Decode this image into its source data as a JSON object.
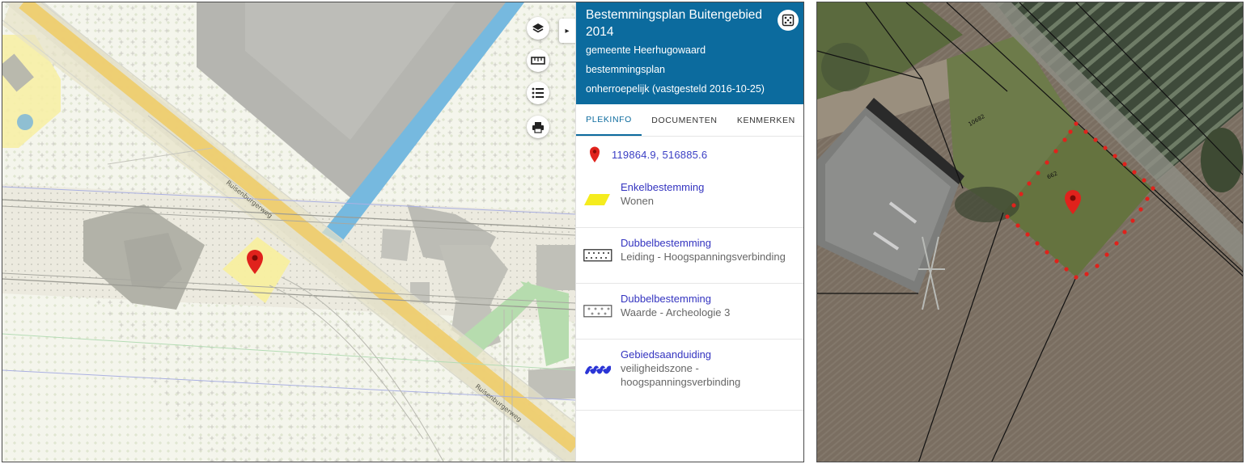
{
  "viewer": {
    "header": {
      "title": "Bestemmingsplan Buitengebied 2014",
      "municipality": "gemeente Heerhugowaard",
      "plan_type": "bestemmingsplan",
      "status": "onherroepelijk (vastgesteld 2016-10-25)"
    },
    "tabs": [
      {
        "label": "PLEKINFO",
        "active": true
      },
      {
        "label": "DOCUMENTEN",
        "active": false
      },
      {
        "label": "KENMERKEN",
        "active": false
      }
    ],
    "coordinates": "119864.9, 516885.6",
    "entries": [
      {
        "type": "Enkelbestemming",
        "name": "Wonen",
        "symbol": "yellow-parallelogram-icon"
      },
      {
        "type": "Dubbelbestemming",
        "name": "Leiding - Hoogspanningsverbinding",
        "symbol": "dotted-box-icon"
      },
      {
        "type": "Dubbelbestemming",
        "name": "Waarde - Archeologie 3",
        "symbol": "cross-hatch-box-icon"
      },
      {
        "type": "Gebiedsaanduiding",
        "name": "veiligheidszone - hoogspanningsverbinding",
        "symbol": "blue-zone-icon"
      }
    ],
    "map": {
      "street_label_1": "Ruisenburgerweg",
      "street_label_2": "Ruisenburgerweg",
      "tools": [
        "layers-icon",
        "ruler-icon",
        "legend-list-icon",
        "print-icon"
      ]
    }
  },
  "aerial": {
    "parcel_label_1": "10682",
    "parcel_label_2": "662"
  },
  "colors": {
    "header_bg": "#0c6b9e",
    "link": "#3434c0",
    "marker": "#e0221c",
    "road": "#f2d37a",
    "water": "#6fb8e0",
    "green_zone": "#a8d9a0",
    "building": "#b8b8b0"
  }
}
